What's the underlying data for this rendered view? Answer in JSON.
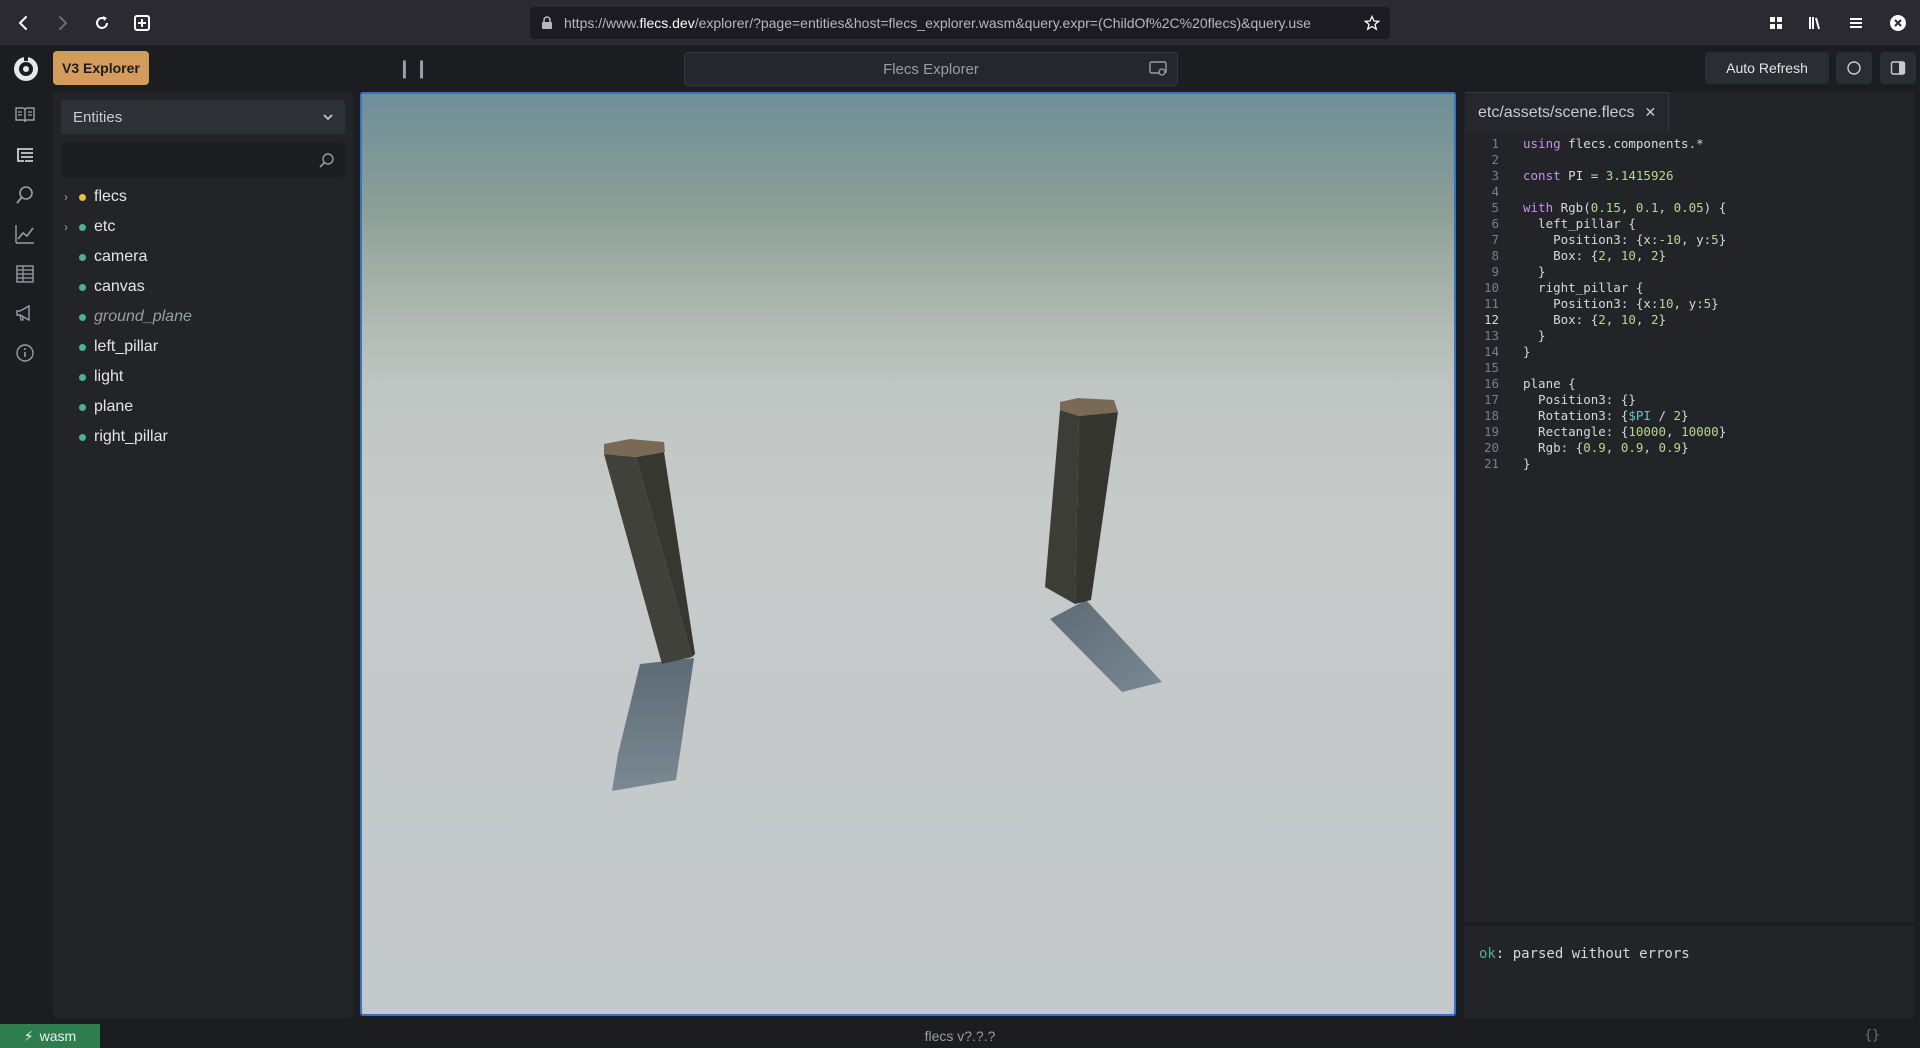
{
  "browser": {
    "url_prefix": "https://www.",
    "url_domain": "flecs.dev",
    "url_suffix": "/explorer/?page=entities&host=flecs_explorer.wasm&query.expr=(ChildOf%2C%20flecs)&query.use"
  },
  "header": {
    "badge": "V3 Explorer",
    "search_placeholder": "Flecs Explorer",
    "auto_refresh": "Auto Refresh"
  },
  "entities": {
    "select_value": "Entities",
    "items": [
      {
        "label": "flecs",
        "dot": "yellow",
        "expandable": true,
        "italic": false
      },
      {
        "label": "etc",
        "dot": "green",
        "expandable": true,
        "italic": false
      },
      {
        "label": "camera",
        "dot": "green",
        "expandable": false,
        "italic": false
      },
      {
        "label": "canvas",
        "dot": "green",
        "expandable": false,
        "italic": false
      },
      {
        "label": "ground_plane",
        "dot": "green",
        "expandable": false,
        "italic": true
      },
      {
        "label": "left_pillar",
        "dot": "green",
        "expandable": false,
        "italic": false
      },
      {
        "label": "light",
        "dot": "green",
        "expandable": false,
        "italic": false
      },
      {
        "label": "plane",
        "dot": "green",
        "expandable": false,
        "italic": false
      },
      {
        "label": "right_pillar",
        "dot": "green",
        "expandable": false,
        "italic": false
      }
    ]
  },
  "editor": {
    "tab": "etc/assets/scene.flecs",
    "current_line": 12,
    "lines": [
      "using flecs.components.*",
      "",
      "const PI = 3.1415926",
      "",
      "with Rgb(0.15, 0.1, 0.05) {",
      "  left_pillar {",
      "    Position3: {x:-10, y:5}",
      "    Box: {2, 10, 2}",
      "  }",
      "  right_pillar {",
      "    Position3: {x:10, y:5}",
      "    Box: {2, 10, 2}",
      "  }",
      "}",
      "",
      "plane {",
      "  Position3: {}",
      "  Rotation3: {$PI / 2}",
      "  Rectangle: {10000, 10000}",
      "  Rgb: {0.9, 0.9, 0.9}",
      "}"
    ],
    "status_ok": "ok",
    "status_msg": ": parsed without errors"
  },
  "footer": {
    "wasm": "wasm",
    "version": "flecs v?.?.?",
    "braces": "{}"
  }
}
